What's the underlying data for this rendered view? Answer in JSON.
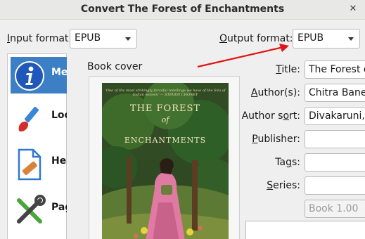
{
  "window": {
    "title": "Convert The Forest of Enchantments",
    "close_glyph": "✕"
  },
  "input_format": {
    "label_pre": "",
    "label_underline": "I",
    "label_post": "nput format:",
    "value": "EPUB"
  },
  "output_format": {
    "label_pre": "",
    "label_underline": "O",
    "label_post": "utput format:",
    "value": "EPUB"
  },
  "sidebar": {
    "items": [
      {
        "label": "Me",
        "icon": "info-icon",
        "selected": true
      },
      {
        "label": "Loo",
        "icon": "paintbrush-icon",
        "selected": false
      },
      {
        "label": "Heu pro",
        "icon": "heuristics-document-icon",
        "selected": false
      },
      {
        "label": "Pag",
        "icon": "wrench-screwdriver-icon",
        "selected": false
      }
    ]
  },
  "cover": {
    "label": "Book cover",
    "top_tagline": "'One of the most strikingly forceful retellings we have of the Sita of Indian women'",
    "top_tagline_source": "— STEVEN CHONEY",
    "title_line1": "THE FOREST",
    "title_line2": "of",
    "title_line3": "ENCHANTMENTS"
  },
  "metadata": {
    "title": {
      "label_pre": "",
      "label_underline": "T",
      "label_post": "itle:",
      "value": "The Forest of Enchantments"
    },
    "authors": {
      "label_pre": "",
      "label_underline": "A",
      "label_post": "uthor(s):",
      "value": "Chitra Banerjee Divakaruni"
    },
    "author_sort": {
      "label_pre": "Author s",
      "label_underline": "o",
      "label_post": "rt:",
      "value": "Divakaruni, Chitra Banerjee"
    },
    "publisher": {
      "label_pre": "",
      "label_underline": "P",
      "label_post": "ublisher:",
      "value": ""
    },
    "tags": {
      "label_pre": "Ta",
      "label_underline": "g",
      "label_post": "s:",
      "value": ""
    },
    "series": {
      "label_pre": "",
      "label_underline": "S",
      "label_post": "eries:",
      "value": ""
    },
    "series_index": {
      "value": "Book 1.00"
    }
  },
  "colors": {
    "selection": "#3d7fc4",
    "arrow": "#e01414"
  }
}
